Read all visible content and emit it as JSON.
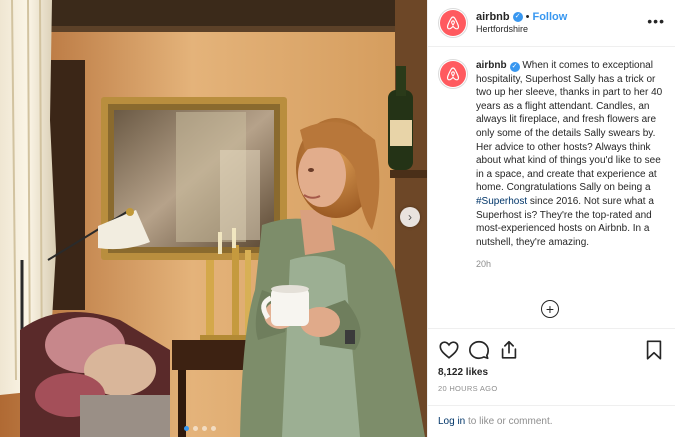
{
  "header": {
    "username": "airbnb",
    "separator": "•",
    "follow_label": "Follow",
    "location": "Hertfordshire",
    "more_label": "•••"
  },
  "caption": {
    "username": "airbnb",
    "text_before_tag": " When it comes to exceptional hospitality, Superhost Sally has a trick or two up her sleeve, thanks in part to her 40 years as a flight attendant. Candles, an always lit fireplace, and fresh flowers are only some of the details Sally swears by. Her advice to other hosts? Always think about what kind of things you'd like to see in a space, and create that experience at home. Congratulations Sally on being a ",
    "hashtag": "#Superhost",
    "text_after_tag": " since 2016. Not sure what a Superhost is? They're the top-rated and most-experienced hosts on Airbnb. In a nutshell, they're amazing.",
    "time": "20h"
  },
  "load_more_symbol": "+",
  "carousel": {
    "next_symbol": "›",
    "slides": 4,
    "active_index": 0
  },
  "stats": {
    "likes": "8,122 likes",
    "posted_ago": "20 HOURS AGO"
  },
  "footer": {
    "login_link": "Log in",
    "login_suffix": " to like or comment."
  },
  "icons": [
    "heart-icon",
    "comment-icon",
    "share-icon",
    "bookmark-icon",
    "verified-badge-icon",
    "airbnb-logo-icon",
    "plus-circle-icon",
    "chevron-right-icon"
  ],
  "colors": {
    "brand": "#ff5a5f",
    "link": "#3897f0",
    "text": "#262626",
    "muted": "#8e8e8e",
    "hashtag": "#003569"
  }
}
